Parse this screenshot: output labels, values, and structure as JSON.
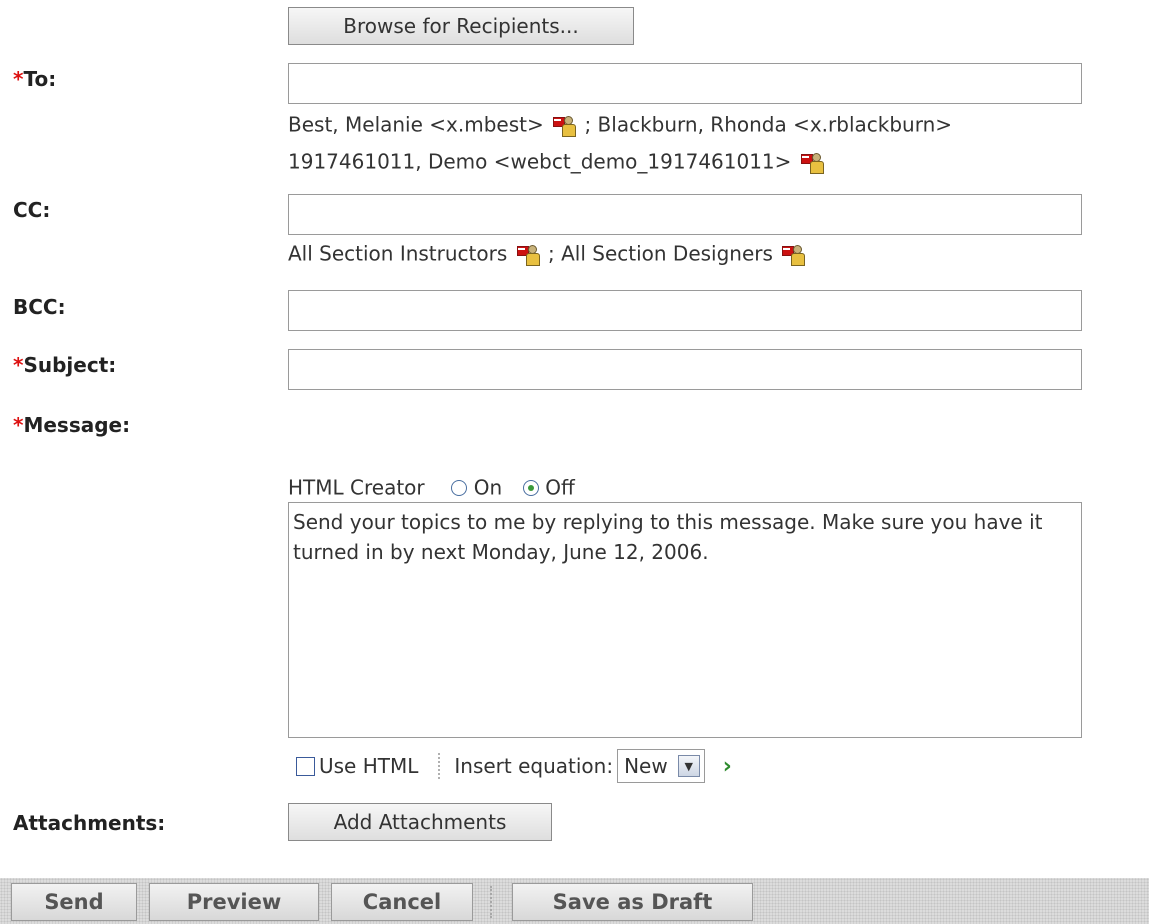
{
  "browse_button": "Browse for Recipients...",
  "required_mark": "*",
  "labels": {
    "to": "To:",
    "cc": "CC:",
    "bcc": "BCC:",
    "subject": "Subject:",
    "message": "Message:",
    "attachments": "Attachments:"
  },
  "to": {
    "value": "",
    "recipients": [
      "Best, Melanie <x.mbest>",
      "; Blackburn, Rhonda <x.rblackburn>",
      "1917461011, Demo <webct_demo_1917461011>"
    ]
  },
  "cc": {
    "value": "",
    "recipients": [
      "All Section Instructors",
      "; All Section Designers"
    ]
  },
  "bcc": {
    "value": ""
  },
  "subject": {
    "value": ""
  },
  "html_creator": {
    "label": "HTML Creator",
    "on_label": "On",
    "off_label": "Off",
    "selected": "Off"
  },
  "message_body": "Send your topics to me by replying to this message.  Make sure you have it turned in by next Monday, June 12, 2006.",
  "editor_toolbar": {
    "use_html_label": "Use HTML",
    "insert_equation_label": "Insert equation:",
    "equation_select_value": "New"
  },
  "add_attachments_button": "Add Attachments",
  "footer_buttons": {
    "send": "Send",
    "preview": "Preview",
    "cancel": "Cancel",
    "save_draft": "Save as Draft"
  },
  "colors": {
    "required": "#dd1111",
    "footer_bg": "#dcdcdc",
    "go_arrow": "#2e8b2e"
  },
  "icons": [
    "recipient-properties-icon",
    "dropdown-arrow-icon",
    "go-arrow-icon"
  ]
}
